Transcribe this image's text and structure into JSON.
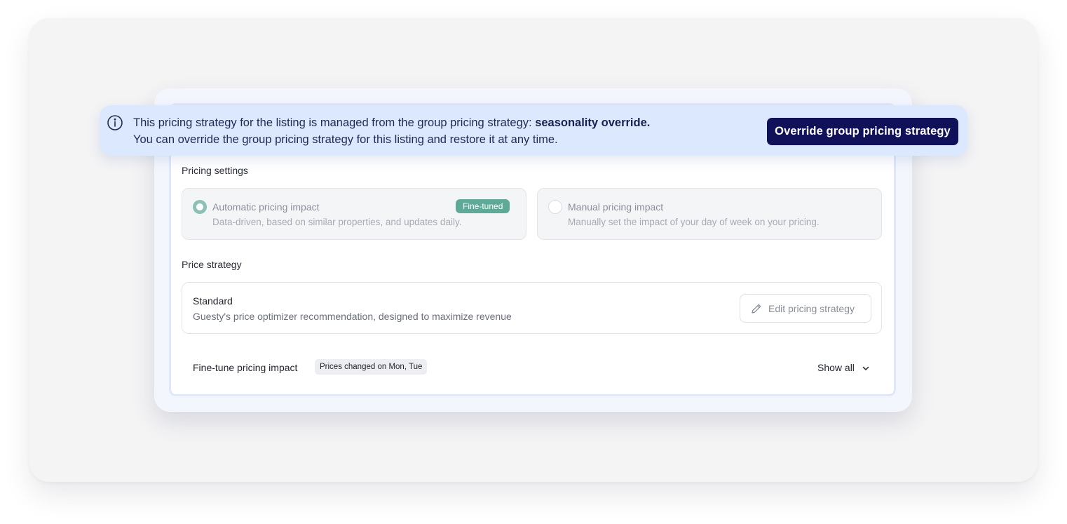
{
  "banner": {
    "text_prefix": "This pricing strategy for the listing is managed from the group pricing strategy: ",
    "strategy_name": "seasonality override.",
    "text_line2": "You can override the group pricing strategy for this listing and restore it at any time.",
    "button_label": "Override group pricing strategy",
    "icon": "info-icon"
  },
  "pricing_settings": {
    "label": "Pricing settings",
    "options": [
      {
        "title": "Automatic pricing impact",
        "description": "Data-driven, based on similar properties, and updates daily.",
        "badge": "Fine-tuned",
        "selected": true
      },
      {
        "title": "Manual pricing impact",
        "description": "Manually set the impact of your day of week on your pricing.",
        "selected": false
      }
    ]
  },
  "price_strategy": {
    "label": "Price strategy",
    "name": "Standard",
    "description": "Guesty's price optimizer recommendation, designed to maximize revenue",
    "edit_label": "Edit pricing strategy",
    "edit_icon": "pencil-icon"
  },
  "fine_tune": {
    "label": "Fine-tune pricing impact",
    "chip": "Prices changed on Mon, Tue",
    "show_all": "Show all",
    "show_all_icon": "chevron-down-icon"
  },
  "colors": {
    "banner_bg": "#dbe8fd",
    "primary_button": "#11115a",
    "badge": "#5fa998",
    "radio_selected": "#8cc2b6"
  }
}
